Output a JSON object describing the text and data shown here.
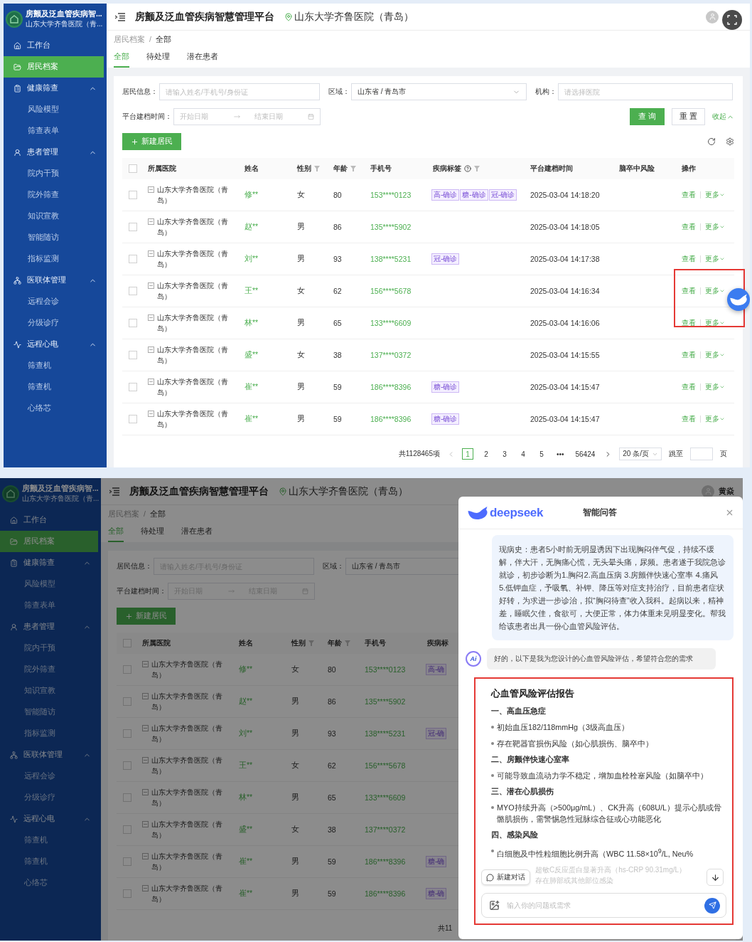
{
  "top_screenshot": {
    "sidebar": {
      "title": "房颤及泛血管疾病智...",
      "subtitle": "山东大学齐鲁医院（青...",
      "items": [
        {
          "label": "工作台",
          "kind": "link",
          "selected": false
        },
        {
          "label": "居民档案",
          "kind": "link",
          "selected": true
        },
        {
          "label": "健康筛查",
          "kind": "group",
          "expanded": true,
          "children": [
            {
              "label": "风险模型",
              "selected": false
            },
            {
              "label": "筛查表单",
              "selected": false
            }
          ]
        },
        {
          "label": "患者管理",
          "kind": "group",
          "expanded": true,
          "children": [
            {
              "label": "院内干预",
              "selected": false
            },
            {
              "label": "院外筛查",
              "selected": false
            },
            {
              "label": "知识宣教",
              "selected": false
            },
            {
              "label": "智能随访",
              "selected": false
            },
            {
              "label": "指标监测",
              "selected": false
            }
          ]
        },
        {
          "label": "医联体管理",
          "kind": "group",
          "expanded": true,
          "children": [
            {
              "label": "远程会诊",
              "selected": false
            },
            {
              "label": "分级诊疗",
              "selected": false
            }
          ]
        },
        {
          "label": "远程心电",
          "kind": "group",
          "expanded": true,
          "children": [
            {
              "label": "筛查机",
              "selected": false
            },
            {
              "label": "筛查机",
              "selected": false
            },
            {
              "label": "心络芯",
              "selected": false
            }
          ]
        }
      ]
    },
    "header": {
      "title": "房颤及泛血管疾病智慧管理平台",
      "hospital": "山东大学齐鲁医院（青岛）"
    },
    "breadcrumb": {
      "items": [
        "居民档案",
        "全部"
      ],
      "separator": "/"
    },
    "tabs": [
      {
        "label": "全部",
        "selected": true
      },
      {
        "label": "待处理",
        "selected": false
      },
      {
        "label": "潜在患者",
        "selected": false
      }
    ],
    "filters": {
      "resident_info": {
        "label": "居民信息：",
        "placeholder": "请输入姓名/手机号/身份证"
      },
      "region": {
        "label": "区域：",
        "value": "山东省 / 青岛市"
      },
      "org": {
        "label": "机构：",
        "placeholder": "请选择医院"
      },
      "date_range": {
        "label": "平台建档时间：",
        "start": "开始日期",
        "end": "结束日期"
      },
      "query": "查 询",
      "reset": "重 置",
      "collapse": "收起"
    },
    "new_button": "新建居民",
    "table_tools": true,
    "table": {
      "all_checked": false,
      "columns": [
        {
          "label": "所属医院"
        },
        {
          "label": "姓名"
        },
        {
          "label": "性别",
          "filter": true
        },
        {
          "label": "年龄",
          "filter": true
        },
        {
          "label": "手机号"
        },
        {
          "label": "疾病标签",
          "filter": true,
          "help": true
        },
        {
          "label": "平台建档时间"
        },
        {
          "label": "脑卒中风险"
        },
        {
          "label": "操作"
        }
      ],
      "rows": [
        {
          "checked": false,
          "hospital": "山东大学齐鲁医院（青岛）",
          "name": "修**",
          "gender": "女",
          "age": "80",
          "phone": "153****0123",
          "tags": [
            "高-确诊",
            "糖-确诊",
            "冠-确诊"
          ],
          "time": "2025-03-04 14:18:20",
          "view": "查看",
          "more": "更多"
        },
        {
          "checked": false,
          "hospital": "山东大学齐鲁医院（青岛）",
          "name": "赵**",
          "gender": "男",
          "age": "86",
          "phone": "135****5902",
          "tags": [],
          "time": "2025-03-04 14:18:05",
          "view": "查看",
          "more": "更多"
        },
        {
          "checked": false,
          "hospital": "山东大学齐鲁医院（青岛）",
          "name": "刘**",
          "gender": "男",
          "age": "93",
          "phone": "138****5231",
          "tags": [
            "冠-确诊"
          ],
          "time": "2025-03-04 14:17:38",
          "view": "查看",
          "more": "更多"
        },
        {
          "checked": false,
          "hospital": "山东大学齐鲁医院（青岛）",
          "name": "王**",
          "gender": "女",
          "age": "62",
          "phone": "156****5678",
          "tags": [],
          "time": "2025-03-04 14:16:34",
          "view": "查看",
          "more": "更多"
        },
        {
          "checked": false,
          "hospital": "山东大学齐鲁医院（青岛）",
          "name": "林**",
          "gender": "男",
          "age": "65",
          "phone": "133****6609",
          "tags": [],
          "time": "2025-03-04 14:16:06",
          "view": "查看",
          "more": "更多"
        },
        {
          "checked": false,
          "hospital": "山东大学齐鲁医院（青岛）",
          "name": "盛**",
          "gender": "女",
          "age": "38",
          "phone": "137****0372",
          "tags": [],
          "time": "2025-03-04 14:15:55",
          "view": "查看",
          "more": "更多"
        },
        {
          "checked": false,
          "hospital": "山东大学齐鲁医院（青岛）",
          "name": "崔**",
          "gender": "男",
          "age": "59",
          "phone": "186****8396",
          "tags": [
            "糖-确诊"
          ],
          "time": "2025-03-04 14:15:47",
          "view": "查看",
          "more": "更多"
        },
        {
          "checked": false,
          "hospital": "山东大学齐鲁医院（青岛）",
          "name": "崔**",
          "gender": "男",
          "age": "59",
          "phone": "186****8396",
          "tags": [
            "糖-确诊"
          ],
          "time": "2025-03-04 14:15:47",
          "view": "查看",
          "more": "更多"
        }
      ]
    },
    "pagination": {
      "total": "共1128465项",
      "pages": [
        {
          "label": "1",
          "selected": true
        },
        {
          "label": "2",
          "selected": false
        },
        {
          "label": "3",
          "selected": false
        },
        {
          "label": "4",
          "selected": false
        },
        {
          "label": "5",
          "selected": false
        },
        {
          "label": "•••",
          "selected": false
        },
        {
          "label": "56424",
          "selected": false
        }
      ],
      "page_size": "20 条/页",
      "jump_label": "跳至",
      "jump_suffix": "页"
    }
  },
  "bottom_screenshot": {
    "dimmed": true,
    "sidebar": {
      "title": "房颤及泛血管疾病智...",
      "subtitle": "山东大学齐鲁医院（青...",
      "items": [
        {
          "label": "工作台",
          "kind": "link",
          "selected": false
        },
        {
          "label": "居民档案",
          "kind": "link",
          "selected": true
        },
        {
          "label": "健康筛查",
          "kind": "group",
          "expanded": true,
          "children": [
            {
              "label": "风险模型",
              "selected": false
            },
            {
              "label": "筛查表单",
              "selected": false
            }
          ]
        },
        {
          "label": "患者管理",
          "kind": "group",
          "expanded": true,
          "children": [
            {
              "label": "院内干预",
              "selected": false
            },
            {
              "label": "院外筛查",
              "selected": false
            },
            {
              "label": "知识宣教",
              "selected": false
            },
            {
              "label": "智能随访",
              "selected": false
            },
            {
              "label": "指标监测",
              "selected": false
            }
          ]
        },
        {
          "label": "医联体管理",
          "kind": "group",
          "expanded": true,
          "children": [
            {
              "label": "远程会诊",
              "selected": false
            },
            {
              "label": "分级诊疗",
              "selected": false
            }
          ]
        },
        {
          "label": "远程心电",
          "kind": "group",
          "expanded": true,
          "children": [
            {
              "label": "筛查机",
              "selected": false
            },
            {
              "label": "筛查机",
              "selected": false
            },
            {
              "label": "心络芯",
              "selected": false
            }
          ]
        }
      ]
    },
    "header": {
      "title": "房颤及泛血管疾病智慧管理平台",
      "hospital": "山东大学齐鲁医院（青岛）",
      "user": "黄焱"
    },
    "breadcrumb": {
      "items": [
        "居民档案",
        "全部"
      ],
      "separator": "/"
    },
    "tabs": [
      {
        "label": "全部",
        "selected": true
      },
      {
        "label": "待处理",
        "selected": false
      },
      {
        "label": "潜在患者",
        "selected": false
      }
    ],
    "filters": {
      "resident_info": {
        "label": "居民信息：",
        "placeholder": "请输入姓名/手机号/身份证"
      },
      "region": {
        "label": "区域：",
        "value": "山东省 / 青岛市"
      },
      "date_range": {
        "label": "平台建档时间：",
        "start": "开始日期",
        "end": "结束日期"
      }
    },
    "new_button": "新建居民",
    "table": {
      "all_checked": false,
      "columns": [
        {
          "label": "所属医院"
        },
        {
          "label": "姓名"
        },
        {
          "label": "性别",
          "filter": true
        },
        {
          "label": "年龄",
          "filter": true
        },
        {
          "label": "手机号"
        },
        {
          "label": "疾病标"
        }
      ],
      "rows": [
        {
          "checked": false,
          "hospital": "山东大学齐鲁医院（青岛）",
          "name": "修**",
          "gender": "女",
          "age": "80",
          "phone": "153****0123",
          "tags": [
            "高-确"
          ]
        },
        {
          "checked": false,
          "hospital": "山东大学齐鲁医院（青岛）",
          "name": "赵**",
          "gender": "男",
          "age": "86",
          "phone": "135****5902",
          "tags": []
        },
        {
          "checked": false,
          "hospital": "山东大学齐鲁医院（青岛）",
          "name": "刘**",
          "gender": "男",
          "age": "93",
          "phone": "138****5231",
          "tags": [
            "冠-确"
          ]
        },
        {
          "checked": false,
          "hospital": "山东大学齐鲁医院（青岛）",
          "name": "王**",
          "gender": "女",
          "age": "62",
          "phone": "156****5678",
          "tags": []
        },
        {
          "checked": false,
          "hospital": "山东大学齐鲁医院（青岛）",
          "name": "林**",
          "gender": "男",
          "age": "65",
          "phone": "133****6609",
          "tags": []
        },
        {
          "checked": false,
          "hospital": "山东大学齐鲁医院（青岛）",
          "name": "盛**",
          "gender": "女",
          "age": "38",
          "phone": "137****0372",
          "tags": []
        },
        {
          "checked": false,
          "hospital": "山东大学齐鲁医院（青岛）",
          "name": "崔**",
          "gender": "男",
          "age": "59",
          "phone": "186****8396",
          "tags": [
            "糖-确"
          ]
        },
        {
          "checked": false,
          "hospital": "山东大学齐鲁医院（青岛）",
          "name": "崔**",
          "gender": "男",
          "age": "59",
          "phone": "186****8396",
          "tags": [
            "糖-确"
          ]
        }
      ]
    },
    "pagination": {
      "total": "共11"
    },
    "chat": {
      "brand": "deepseek",
      "title": "智能问答",
      "user_message": "现病史：患者5小时前无明显诱因下出现胸闷伴气促，持续不缓解，伴大汗，无胸痛心慌，无头晕头痛，尿频。患者遂于我院急诊就诊，初步诊断为1.胸闷2.高血压病 3.房颤伴快速心室率 4.痛风 5.低钾血症，予吸氧、补钾、降压等对症支持治疗，目前患者症状好转，为求进一步诊治，拟“胸闷待查”收入我科。起病以来，精神差，睡眠欠佳，食欲可，大便正常，体力体重未见明显变化。帮我给该患者出具一份心血管风险评估。",
      "ai_badge": "Ai",
      "ai_intro": "好的，以下是我为您设计的心血管风险评估，希望符合您的需求",
      "report": {
        "title": "心血管风险评估报告",
        "sections": [
          {
            "heading": "一、高血压急症",
            "bullets": [
              "初始血压182/118mmHg（3级高血压）",
              "存在靶器官损伤风险（如心肌损伤、脑卒中）"
            ]
          },
          {
            "heading": "二、房颤伴快速心室率",
            "bullets": [
              "可能导致血流动力学不稳定，增加血栓栓塞风险（如脑卒中）"
            ]
          },
          {
            "heading": "三、潜在心肌损伤",
            "bullets": [
              "MYO持续升高（>500μg/mL）、CK升高（608U/L）提示心肌或骨骼肌损伤，需警惕急性冠脉综合征或心功能恶化"
            ]
          },
          {
            "heading": "四、感染风险",
            "bullets": [
              "白细胞及中性粒细胞比例升高（WBC 11.58×10$^{9}$/L, Neu%"
            ]
          }
        ],
        "faded_lines": [
          "超敏C反应蛋白显著升高（hs-CRP 90.31mg/L）",
          "存在肺部或其他部位感染"
        ]
      },
      "new_chat": "新建对话",
      "input": {
        "placeholder": "输入你的问题或需求"
      }
    }
  }
}
